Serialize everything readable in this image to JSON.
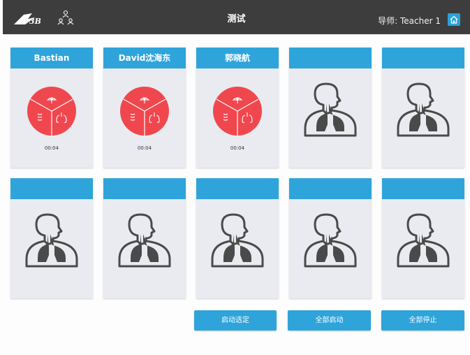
{
  "header": {
    "title": "测试",
    "teacher_label": "导师: Teacher 1",
    "logo_icon": "3b-logo",
    "trainer_icon": "group-icon",
    "home_icon": "home-icon",
    "accent": "#2ea4db"
  },
  "students": [
    {
      "name": "Bastian",
      "status": "active",
      "timer": "00:04"
    },
    {
      "name": "David沈海东",
      "status": "active",
      "timer": "00:04"
    },
    {
      "name": "郭晓航",
      "status": "active",
      "timer": "00:04"
    },
    {
      "name": "",
      "status": "idle",
      "timer": ""
    },
    {
      "name": "",
      "status": "idle",
      "timer": ""
    },
    {
      "name": "",
      "status": "idle",
      "timer": ""
    },
    {
      "name": "",
      "status": "idle",
      "timer": ""
    },
    {
      "name": "",
      "status": "idle",
      "timer": ""
    },
    {
      "name": "",
      "status": "idle",
      "timer": ""
    },
    {
      "name": "",
      "status": "idle",
      "timer": ""
    }
  ],
  "actions": {
    "start_selected": "启动选定",
    "start_all": "全部启动",
    "stop_all": "全部停止"
  },
  "colors": {
    "alert_red": "#f0474e",
    "header_bg": "#3d3d3d",
    "card_bg": "#e9ebf0"
  }
}
